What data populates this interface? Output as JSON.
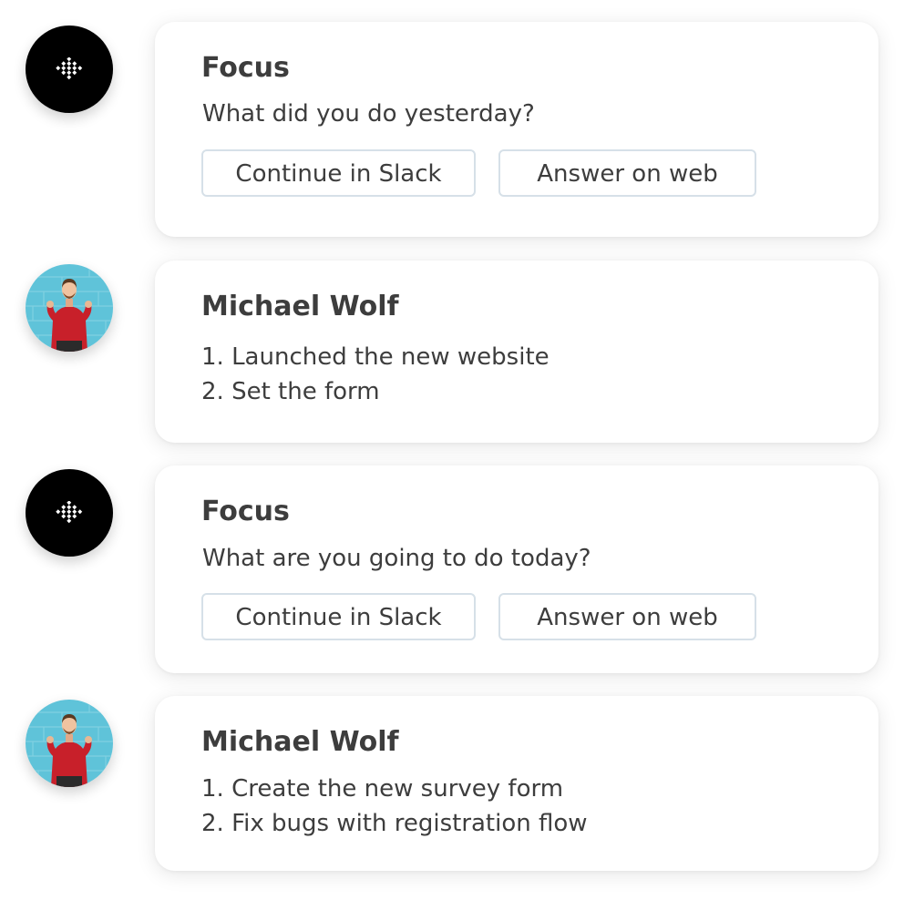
{
  "messages": [
    {
      "author": "Focus",
      "type": "bot",
      "question": "What did you do yesterday?",
      "buttons": [
        "Continue in Slack",
        "Answer on web"
      ]
    },
    {
      "author": "Michael Wolf",
      "type": "user",
      "items": [
        "1. Launched the new website",
        "2. Set the form"
      ]
    },
    {
      "author": "Focus",
      "type": "bot",
      "question": "What are you going to do today?",
      "buttons": [
        "Continue in Slack",
        "Answer on web"
      ]
    },
    {
      "author": "Michael Wolf",
      "type": "user",
      "items": [
        "1. Create the new survey form",
        "2. Fix bugs with registration flow"
      ]
    }
  ],
  "icons": {
    "bot_avatar": "focus-logo-icon",
    "user_avatar": "user-photo"
  },
  "colors": {
    "text": "#3d3d3d",
    "bot_avatar_bg": "#000000",
    "button_border": "#d6e0e8",
    "card_bg": "#ffffff"
  }
}
